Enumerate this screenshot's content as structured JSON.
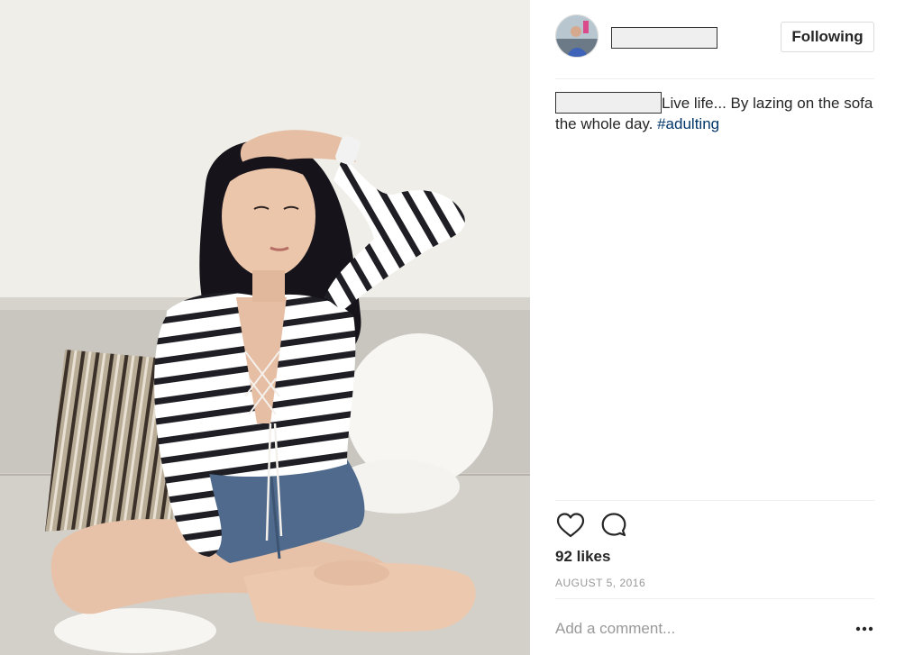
{
  "post": {
    "follow_label": "Following",
    "caption_text": "Live life... By lazing on the sofa the whole day. ",
    "caption_hashtag": "#adulting",
    "likes": "92 likes",
    "date": "AUGUST 5, 2016",
    "comment_placeholder": "Add a comment..."
  },
  "icons": {
    "like": "heart-icon",
    "comment": "comment-bubble-icon",
    "more": "more-options-icon"
  },
  "colors": {
    "text": "#262626",
    "muted": "#999999",
    "hashtag": "#003569",
    "divider": "#efefef",
    "button_border": "#dbdbdb"
  }
}
